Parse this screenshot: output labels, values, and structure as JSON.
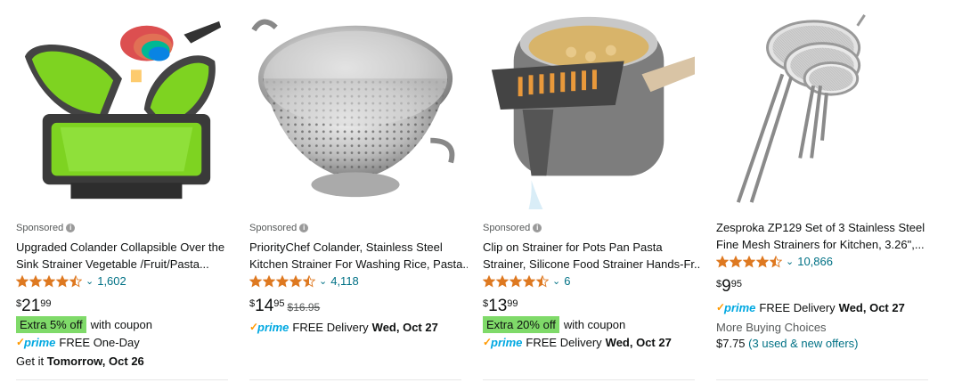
{
  "products": [
    {
      "sponsored": "Sponsored",
      "title_lines": [
        "Upgraded Colander Collapsible Over the",
        "Sink Strainer Vegetable /Fruit/Pasta..."
      ],
      "rating": 4.5,
      "review_count": "1,602",
      "price_symbol": "$",
      "price_whole": "21",
      "price_frac": "99",
      "coupon_badge": "Extra 5% off",
      "coupon_text": "with coupon",
      "prime_label": "prime",
      "delivery_text": "FREE One-Day",
      "get_it_prefix": "Get it",
      "get_it_date": "Tomorrow, Oct 26"
    },
    {
      "sponsored": "Sponsored",
      "title_lines": [
        "PriorityChef Colander, Stainless Steel",
        "Kitchen Strainer For Washing Rice, Pasta..."
      ],
      "rating": 4.5,
      "review_count": "4,118",
      "price_symbol": "$",
      "price_whole": "14",
      "price_frac": "95",
      "old_price": "$16.95",
      "prime_label": "prime",
      "delivery_text": "FREE Delivery",
      "delivery_date": "Wed, Oct 27"
    },
    {
      "sponsored": "Sponsored",
      "title_lines": [
        "Clip on Strainer for Pots Pan Pasta",
        "Strainer, Silicone Food Strainer Hands-Fr..."
      ],
      "rating": 4.5,
      "review_count": "6",
      "price_symbol": "$",
      "price_whole": "13",
      "price_frac": "99",
      "coupon_badge": "Extra 20% off",
      "coupon_text": "with coupon",
      "prime_label": "prime",
      "delivery_text": "FREE Delivery",
      "delivery_date": "Wed, Oct 27"
    },
    {
      "title_lines": [
        "Zesproka ZP129 Set of 3 Stainless Steel",
        "Fine Mesh Strainers for Kitchen, 3.26\",..."
      ],
      "rating": 4.5,
      "review_count": "10,866",
      "price_symbol": "$",
      "price_whole": "9",
      "price_frac": "95",
      "prime_label": "prime",
      "delivery_text": "FREE Delivery",
      "delivery_date": "Wed, Oct 27",
      "more_choices": "More Buying Choices",
      "offer_price": "$7.75",
      "offer_link": "(3 used & new offers)"
    }
  ],
  "colors": {
    "star": "#de7921",
    "link": "#007185",
    "coupon": "#7fda69",
    "prime_blue": "#00a8e1",
    "prime_check": "#ff9900"
  }
}
